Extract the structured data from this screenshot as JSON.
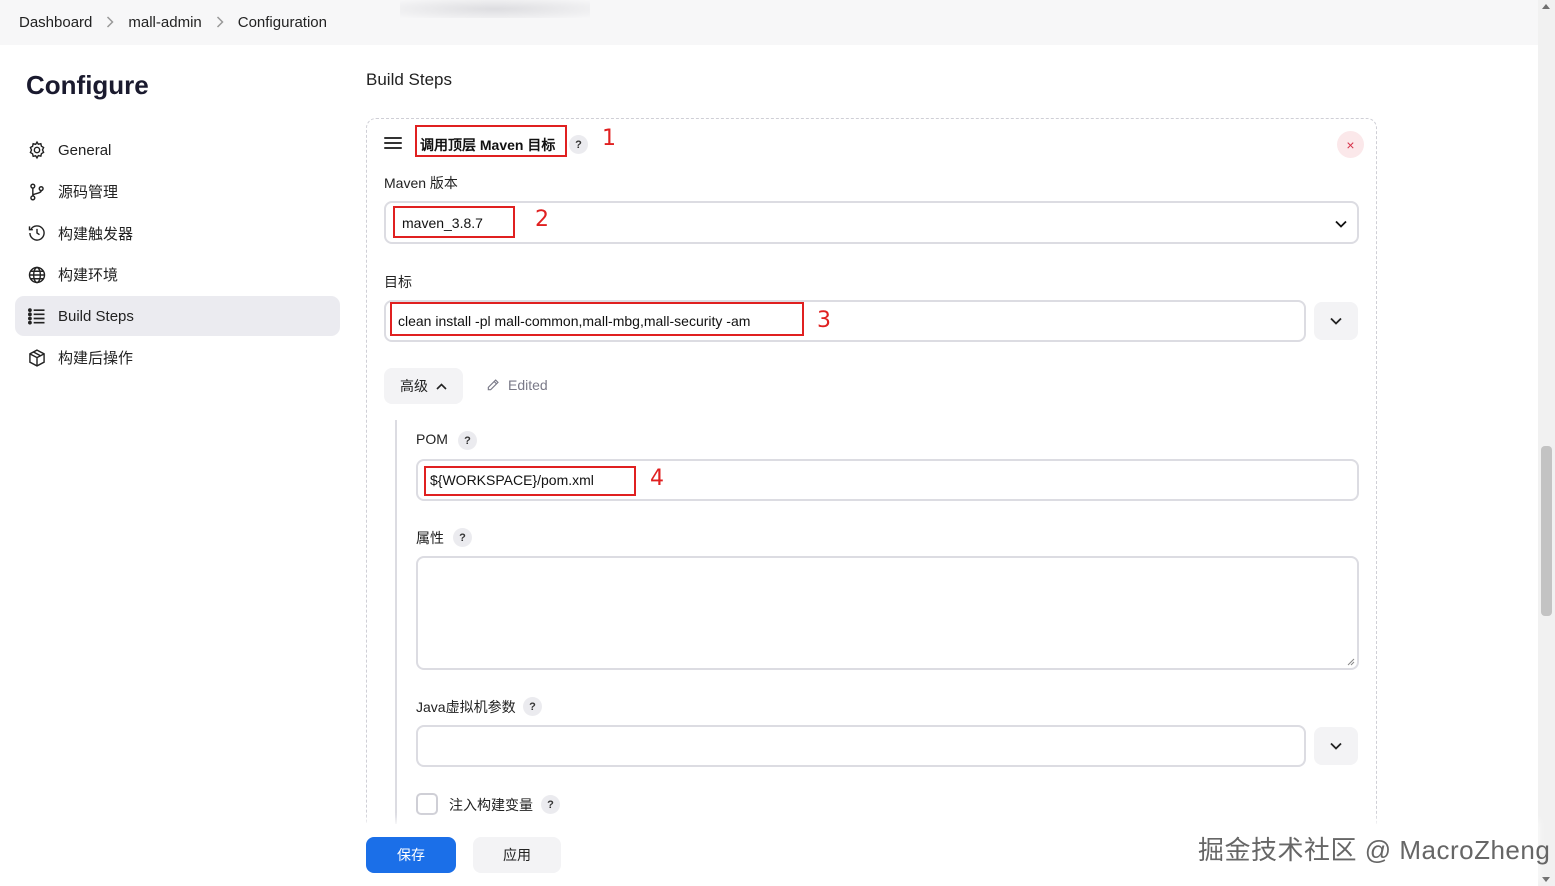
{
  "breadcrumb": [
    "Dashboard",
    "mall-admin",
    "Configuration"
  ],
  "page_title": "Configure",
  "sidebar": {
    "items": [
      {
        "label": "General",
        "icon": "gear-icon"
      },
      {
        "label": "源码管理",
        "icon": "branch-icon"
      },
      {
        "label": "构建触发器",
        "icon": "clock-icon"
      },
      {
        "label": "构建环境",
        "icon": "globe-icon"
      },
      {
        "label": "Build Steps",
        "icon": "list-icon",
        "active": true
      },
      {
        "label": "构建后操作",
        "icon": "package-icon"
      }
    ]
  },
  "main": {
    "section_title": "Build Steps",
    "step": {
      "title": "调用顶层 Maven 目标",
      "help": "?",
      "close": "×",
      "maven_version_label": "Maven 版本",
      "maven_version_value": "maven_3.8.7",
      "goals_label": "目标",
      "goals_value": "clean install -pl mall-common,mall-mbg,mall-security -am",
      "advanced_label": "高级",
      "edited_label": "Edited",
      "pom_label": "POM",
      "pom_value": "${WORKSPACE}/pom.xml",
      "properties_label": "属性",
      "properties_value": "",
      "jvm_label": "Java虚拟机参数",
      "jvm_value": "",
      "inject_label": "注入构建变量"
    }
  },
  "buttons": {
    "save": "保存",
    "apply": "应用"
  },
  "annotations": [
    "1",
    "2",
    "3",
    "4"
  ],
  "watermark": "掘金技术社区 @ MacroZheng",
  "colors": {
    "primary": "#1b6fe8",
    "annotation": "#e02020",
    "active_nav": "#ebebf0",
    "danger": "#d6324a"
  }
}
